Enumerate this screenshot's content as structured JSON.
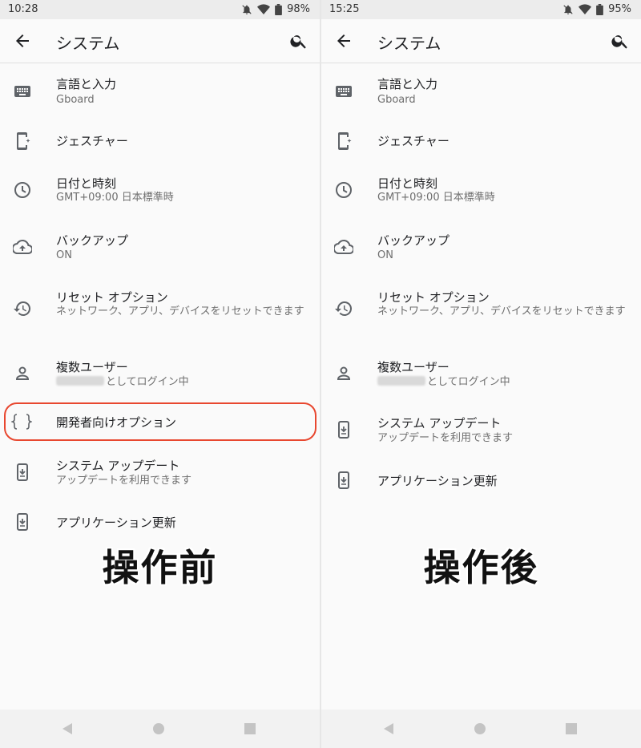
{
  "left": {
    "status": {
      "time": "10:28",
      "battery": "98%"
    },
    "app_bar": {
      "title": "システム"
    },
    "items": [
      {
        "title": "言語と入力",
        "sub": "Gboard",
        "icon": "keyboard-icon"
      },
      {
        "title": "ジェスチャー",
        "sub": "",
        "icon": "gesture-phone-icon"
      },
      {
        "title": "日付と時刻",
        "sub": "GMT+09:00 日本標準時",
        "icon": "clock-icon"
      },
      {
        "title": "バックアップ",
        "sub": "ON",
        "icon": "cloud-upload-icon"
      },
      {
        "title": "リセット オプション",
        "sub": "ネットワーク、アプリ、デバイスをリセットできます",
        "icon": "history-icon"
      },
      {
        "title": "複数ユーザー",
        "sub": "としてログイン中",
        "icon": "person-icon"
      },
      {
        "title": "開発者向けオプション",
        "sub": "",
        "icon": "braces-icon"
      },
      {
        "title": "システム アップデート",
        "sub": "アップデートを利用できます",
        "icon": "system-update-icon"
      },
      {
        "title": "アプリケーション更新",
        "sub": "",
        "icon": "system-update-icon"
      }
    ],
    "caption": "操作前"
  },
  "right": {
    "status": {
      "time": "15:25",
      "battery": "95%"
    },
    "app_bar": {
      "title": "システム"
    },
    "items": [
      {
        "title": "言語と入力",
        "sub": "Gboard",
        "icon": "keyboard-icon"
      },
      {
        "title": "ジェスチャー",
        "sub": "",
        "icon": "gesture-phone-icon"
      },
      {
        "title": "日付と時刻",
        "sub": "GMT+09:00 日本標準時",
        "icon": "clock-icon"
      },
      {
        "title": "バックアップ",
        "sub": "ON",
        "icon": "cloud-upload-icon"
      },
      {
        "title": "リセット オプション",
        "sub": "ネットワーク、アプリ、デバイスをリセットできます",
        "icon": "history-icon"
      },
      {
        "title": "複数ユーザー",
        "sub": "としてログイン中",
        "icon": "person-icon"
      },
      {
        "title": "システム アップデート",
        "sub": "アップデートを利用できます",
        "icon": "system-update-icon"
      },
      {
        "title": "アプリケーション更新",
        "sub": "",
        "icon": "system-update-icon"
      }
    ],
    "caption": "操作後"
  },
  "colors": {
    "highlight": "#e8472f",
    "icon": "#5f6368",
    "subtitle": "#6e6e6e"
  }
}
